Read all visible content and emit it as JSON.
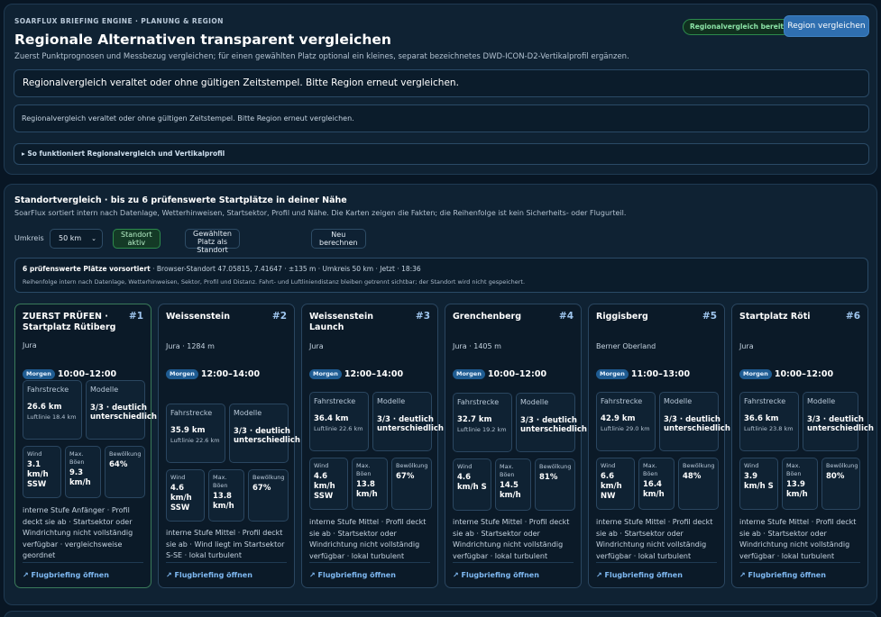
{
  "header": {
    "eyebrow": "SOARFLUX BRIEFING ENGINE · PLANUNG & REGION",
    "title": "Regionale Alternativen transparent vergleichen",
    "subtitle": "Zuerst Punktprognosen und Messbezug vergleichen; für einen gewählten Platz optional ein kleines, separat bezeichnetes DWD-ICON-D2-Vertikalprofil ergänzen.",
    "status_badge": "Regionalvergleich bereit",
    "compare_button": "Region vergleichen"
  },
  "alerts": {
    "primary": "Regionalvergleich veraltet oder ohne gültigen Zeitstempel. Bitte Region erneut vergleichen.",
    "secondary": "Regionalvergleich veraltet oder ohne gültigen Zeitstempel. Bitte Region erneut vergleichen."
  },
  "details_toggle": "▸ So funktioniert Regionalvergleich und Vertikalprofil",
  "comparison": {
    "title": "Standortvergleich · bis zu 6 prüfenswerte Startplätze in deiner Nähe",
    "subtitle": "SoarFlux sortiert intern nach Datenlage, Wetterhinweisen, Startsektor, Profil und Nähe. Die Karten zeigen die Fakten; die Reihenfolge ist kein Sicherheits- oder Flugurteil.",
    "radius_label": "Umkreis",
    "radius_value": "50 km",
    "btn_location_active": "Standort aktiv",
    "btn_use_selected": "Gewählten Platz als Standort",
    "btn_recalculate": "Neu berechnen",
    "info_bold": "6 prüfenswerte Plätze vorsortiert",
    "info_rest": " · Browser-Standort 47.05815, 7.41647 · ±135 m · Umkreis 50 km · Jetzt · 18:36",
    "info_line2": "Reihenfolge intern nach Datenlage, Wetterhinweisen, Sektor, Profil und Distanz. Fahrt- und Luftliniendistanz bleiben getrennt sichtbar; der Standort wird nicht gespeichert."
  },
  "cards": [
    {
      "title": "ZUERST PRÜFEN · Startplatz Rütiberg",
      "rank": "#1",
      "region": "Jura",
      "slot_badge": "Morgen",
      "slot_time": "10:00–12:00",
      "route_label": "Fahrstrecke",
      "route_value": "26.6 km",
      "route_sub": "Luftlinie 18.4 km",
      "models_label": "Modelle",
      "models_value": "3/3 · deutlich unterschiedlich",
      "wind_label": "Wind",
      "wind_value": "3.1 km/h SSW",
      "gust_label": "Max. Böen",
      "gust_value": "9.3 km/h",
      "cloud_label": "Bewölkung",
      "cloud_value": "64%",
      "note": "interne Stufe Anfänger · Profil deckt sie ab · Startsektor oder Windrichtung nicht vollständig verfügbar · vergleichsweise geordnet",
      "link": "↗ Flugbriefing öffnen"
    },
    {
      "title": "Weissenstein",
      "rank": "#2",
      "region": "Jura · 1284 m",
      "slot_badge": "Morgen",
      "slot_time": "12:00–14:00",
      "route_label": "Fahrstrecke",
      "route_value": "35.9 km",
      "route_sub": "Luftlinie 22.6 km",
      "models_label": "Modelle",
      "models_value": "3/3 · deutlich unterschiedlich",
      "wind_label": "Wind",
      "wind_value": "4.6 km/h SSW",
      "gust_label": "Max. Böen",
      "gust_value": "13.8 km/h",
      "cloud_label": "Bewölkung",
      "cloud_value": "67%",
      "note": "interne Stufe Mittel · Profil deckt sie ab · Wind liegt im Startsektor S-SE · lokal turbulent",
      "link": "↗ Flugbriefing öffnen"
    },
    {
      "title": "Weissenstein Launch",
      "rank": "#3",
      "region": "Jura",
      "slot_badge": "Morgen",
      "slot_time": "12:00–14:00",
      "route_label": "Fahrstrecke",
      "route_value": "36.4 km",
      "route_sub": "Luftlinie 22.6 km",
      "models_label": "Modelle",
      "models_value": "3/3 · deutlich unterschiedlich",
      "wind_label": "Wind",
      "wind_value": "4.6 km/h SSW",
      "gust_label": "Max. Böen",
      "gust_value": "13.8 km/h",
      "cloud_label": "Bewölkung",
      "cloud_value": "67%",
      "note": "interne Stufe Mittel · Profil deckt sie ab · Startsektor oder Windrichtung nicht vollständig verfügbar · lokal turbulent",
      "link": "↗ Flugbriefing öffnen"
    },
    {
      "title": "Grenchenberg",
      "rank": "#4",
      "region": "Jura · 1405 m",
      "slot_badge": "Morgen",
      "slot_time": "10:00–12:00",
      "route_label": "Fahrstrecke",
      "route_value": "32.7 km",
      "route_sub": "Luftlinie 19.2 km",
      "models_label": "Modelle",
      "models_value": "3/3 · deutlich unterschiedlich",
      "wind_label": "Wind",
      "wind_value": "4.6 km/h S",
      "gust_label": "Max. Böen",
      "gust_value": "14.5 km/h",
      "cloud_label": "Bewölkung",
      "cloud_value": "81%",
      "note": "interne Stufe Mittel · Profil deckt sie ab · Startsektor oder Windrichtung nicht vollständig verfügbar · lokal turbulent",
      "link": "↗ Flugbriefing öffnen"
    },
    {
      "title": "Riggisberg",
      "rank": "#5",
      "region": "Berner Oberland",
      "slot_badge": "Morgen",
      "slot_time": "11:00–13:00",
      "route_label": "Fahrstrecke",
      "route_value": "42.9 km",
      "route_sub": "Luftlinie 29.0 km",
      "models_label": "Modelle",
      "models_value": "3/3 · deutlich unterschiedlich",
      "wind_label": "Wind",
      "wind_value": "6.6 km/h NW",
      "gust_label": "Max. Böen",
      "gust_value": "16.4 km/h",
      "cloud_label": "Bewölkung",
      "cloud_value": "48%",
      "note": "interne Stufe Mittel · Profil deckt sie ab · Startsektor oder Windrichtung nicht vollständig verfügbar · lokal turbulent",
      "link": "↗ Flugbriefing öffnen"
    },
    {
      "title": "Startplatz Röti",
      "rank": "#6",
      "region": "Jura",
      "slot_badge": "Morgen",
      "slot_time": "10:00–12:00",
      "route_label": "Fahrstrecke",
      "route_value": "36.6 km",
      "route_sub": "Luftlinie 23.8 km",
      "models_label": "Modelle",
      "models_value": "3/3 · deutlich unterschiedlich",
      "wind_label": "Wind",
      "wind_value": "3.9 km/h S",
      "gust_label": "Max. Böen",
      "gust_value": "13.9 km/h",
      "cloud_label": "Bewölkung",
      "cloud_value": "80%",
      "note": "interne Stufe Mittel · Profil deckt sie ab · Startsektor oder Windrichtung nicht vollständig verfügbar · lokal turbulent",
      "link": "↗ Flugbriefing öffnen"
    }
  ]
}
